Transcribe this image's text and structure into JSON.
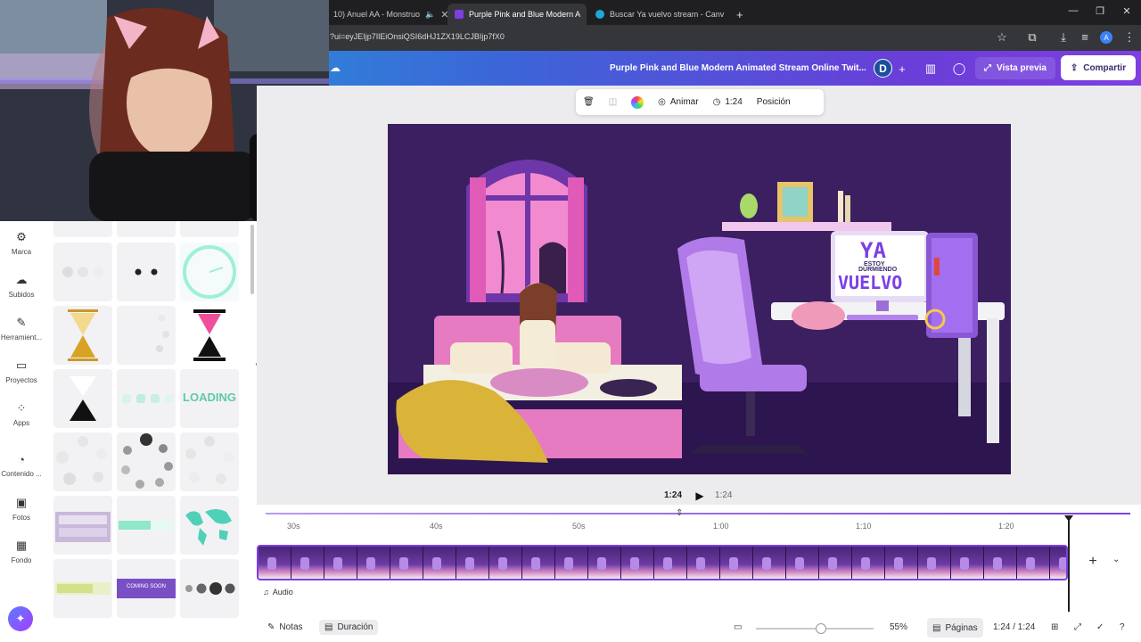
{
  "browser": {
    "tabs": [
      {
        "label": "10) Anuel AA - Monstruo",
        "active": false
      },
      {
        "label": "Purple Pink and Blue Modern A",
        "active": true
      },
      {
        "label": "Buscar Ya vuelvo stream - Canv",
        "active": false
      }
    ],
    "new_tab_label": "+",
    "url": "?ui=eyJEIjp7IlEiOnsiQSI6dHJ1ZX19LCJBIjp7fX0",
    "profile_initial": "A"
  },
  "canva_header": {
    "title": "Purple Pink and Blue Modern Animated Stream Online Twit...",
    "avatar_initial": "D",
    "preview_label": "Vista previa",
    "share_label": "Compartir"
  },
  "left_rail": [
    {
      "label": "Marca",
      "icon": "brand-icon"
    },
    {
      "label": "Subidos",
      "icon": "upload-cloud-icon"
    },
    {
      "label": "Herramient...",
      "icon": "pen-tool-icon"
    },
    {
      "label": "Proyectos",
      "icon": "folder-icon"
    },
    {
      "label": "Apps",
      "icon": "apps-grid-icon"
    },
    {
      "label": "Contenido ...",
      "icon": "content-icon"
    },
    {
      "label": "Fotos",
      "icon": "photo-icon"
    },
    {
      "label": "Fondo",
      "icon": "background-pattern-icon"
    }
  ],
  "panel": {
    "loading_text": "LOADING",
    "coming_soon_text": "COMING SOON"
  },
  "canvas_toolbar": {
    "animate_label": "Animar",
    "duration_label": "1:24",
    "position_label": "Posición"
  },
  "design": {
    "screen_line1": "YA",
    "screen_line2": "ESTOY",
    "screen_line3": "DURMIENDO",
    "screen_line4": "VUELVO"
  },
  "playback": {
    "current_time": "1:24",
    "total_time": "1:24"
  },
  "timeline": {
    "ruler_labels": [
      "30s",
      "40s",
      "50s",
      "1:00",
      "1:10",
      "1:20"
    ],
    "audio_label": "Audio",
    "playhead_fraction": 1.0
  },
  "footer": {
    "notes_label": "Notas",
    "duration_label": "Duración",
    "zoom_value": "55%",
    "zoom_fraction": 0.55,
    "pages_label": "Páginas",
    "page_counter": "1:24 / 1:24"
  },
  "colors": {
    "canva_gradient_start": "#1ca8d8",
    "canva_gradient_end": "#7d3fe0",
    "timeline_accent": "#7b3fe4"
  }
}
